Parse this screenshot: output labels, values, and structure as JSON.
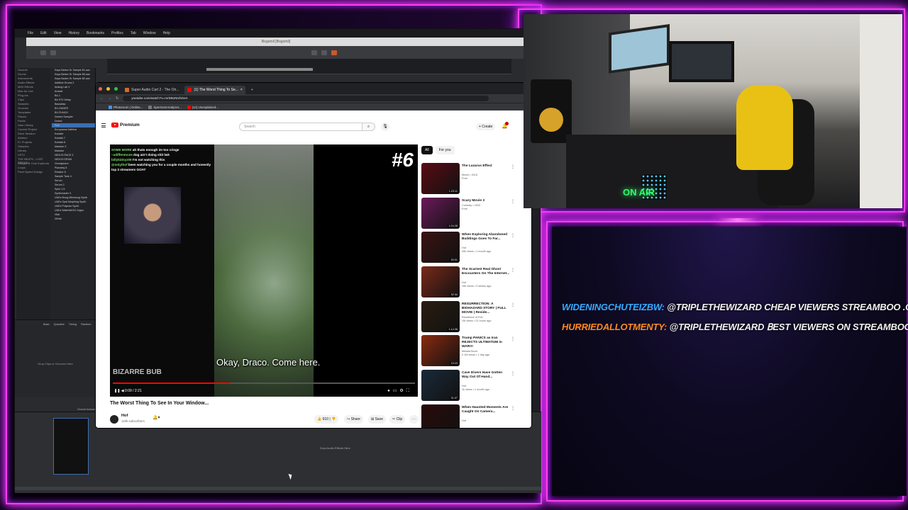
{
  "daw": {
    "menu": [
      "File",
      "Edit",
      "View",
      "History",
      "Bookmarks",
      "Profiles",
      "Tab",
      "Window",
      "Help"
    ],
    "window_title": "Bogomil [Bogomil]",
    "plugins": [
      "Kaya Barker Dr Sample B1.aax",
      "Kaya Barker Dr Sample B4.aax",
      "Kaya Barker Dr Sample B2.aax",
      "Additive Drums 2",
      "Analog Lab V",
      "Arcade",
      "BA-1",
      "BA STX Delay",
      "Bassalisa",
      "BX-HAVIER",
      "BX-PUNCH",
      "Decent Sampler",
      "Dexed",
      "Flux",
      "Europeana Gallrina",
      "Kontakt",
      "Kontakt 7",
      "Kontakt 8",
      "Massive X",
      "Massive",
      "NEXUS RACE 3",
      "NEXUS DRUM",
      "Omnisphere",
      "Pianoteq 8",
      "Reactor 6",
      "Sample Tank 4",
      "Serum",
      "Serum 2",
      "Spire 1.5",
      "Synthmaster 3",
      "UADx Moog Minimoog Synth",
      "UADx Opal Morphing Synth",
      "UADx Polymax Synth",
      "UADx Waterfall B3 Organ",
      "Vital",
      "Xfinite"
    ],
    "categories": [
      "Sounds",
      "Drums",
      "Instruments",
      "Audio Effects",
      "MIDI Effects",
      "Max for Live",
      "Plug-Ins",
      "Clips",
      "Samples",
      "Grooves",
      "Templates",
      "Places",
      "Packs",
      "User Library",
      "Current Project",
      "Drive Session",
      "Ableton",
      "FL Projects",
      "Samples",
      "Library",
      "VST2",
      "THE BEATS - LOST TREASU",
      "Ranges & Club Euphoria",
      "Loops",
      "Fleet Speed Design"
    ],
    "clip_headers": [
      "Base",
      "Quantize",
      "Timing",
      "Random",
      "Vel"
    ],
    "drop_clips": "Drop Clips or Grooves Here",
    "drop_fx": "Drop Audio Effects Here",
    "groove_label": "Groove Amount"
  },
  "browser": {
    "tabs": [
      {
        "label": "Super Audio Cart 2 - The Ori..."
      },
      {
        "label": "(1) The Worst Thing To Se..."
      }
    ],
    "url": "youtube.com/watch?v=mrD8oNIchGeA",
    "bookmarks": [
      "Photoroom | Online...",
      "SpectrumAnalyzer...",
      "(14) Unexplained..."
    ]
  },
  "youtube": {
    "premium_label": "Premium",
    "search_placeholder": "Search",
    "create_label": "+ Create",
    "chat_overlay": [
      {
        "user": "SOME MORE",
        "text": "ah thats enough im too cringe"
      },
      {
        "user": "~adifferencee",
        "text": "dog ain't doing shit lwk"
      },
      {
        "user": "billykidnyz09",
        "text": "I'm not watching this"
      },
      {
        "user": "@onlythof",
        "text": "been watching you for a couple months and honestly top 3 streamers GOAT"
      }
    ],
    "episode": "#6",
    "subtitle": "Okay, Draco. Come here.",
    "watermark": "BIZARRE BUB",
    "progress": 0.39,
    "time": "0:09 / 2:21",
    "video_title": "The Worst Thing To See In Your Window...",
    "channel_name": "Hof",
    "channel_subs": "119k subscribers",
    "likes": "610",
    "share": "Share",
    "save": "Save",
    "clip": "Clip",
    "chips": [
      "All",
      "For you"
    ],
    "recommendations": [
      {
        "title": "The Lazarus Effect",
        "meta1": "Movie • 2015",
        "meta2": "Free",
        "duration": "1:23:11",
        "thumb": "#5a0b14"
      },
      {
        "title": "Scary Movie 3",
        "meta1": "Comedy • 2003",
        "meta2": "Free",
        "duration": "1:24:28",
        "thumb": "#6b1a5a"
      },
      {
        "title": "When Exploring Abandoned Buildings Goes To Far...",
        "meta1": "Hof",
        "meta2": "49k views • 1 month ago",
        "duration": "30:01",
        "thumb": "#3b1212"
      },
      {
        "title": "The Scariest Real Ghost Encounters On The Internet...",
        "meta1": "Hof",
        "meta2": "15k views • 3 weeks ago",
        "duration": "32:34",
        "thumb": "#7a2a1a"
      },
      {
        "title": "RESURRECTION: A BIOHAZARD STORY | FULL MOVIE | Reside...",
        "meta1": "Residence of Evil",
        "meta2": "1M views • 21 hours ago",
        "duration": "1:14:38",
        "thumb": "#2a1d10"
      },
      {
        "title": "Trump PANICS as Iran REJECTS ULTIMATUM in WAR!!!",
        "meta1": "MeidasTouch",
        "meta2": "2.1M views • 1 day ago",
        "duration": "19:23",
        "thumb": "#8a2a10"
      },
      {
        "title": "Cave Divers Have Gotten Way Out Of Hand...",
        "meta1": "Hof",
        "meta2": "1k views • 1 month ago",
        "duration": "31:07",
        "thumb": "#1a2a3a"
      },
      {
        "title": "When Haunted Moments Are Caught On Camera...",
        "meta1": "Hof",
        "meta2": "",
        "duration": "",
        "thumb": "#2a0a0a"
      }
    ]
  },
  "webcam": {
    "sign": "ON AIR"
  },
  "chat": {
    "messages": [
      {
        "user": "WIDENINGCHUTEIZBW:",
        "text": "@TRIPLETHEWIZARD CHEAP VIEWERS STREAMBOO .COM (R"
      },
      {
        "user": "HURRIEDALLOTMENTY:",
        "text": "@TRIPLETHEWIZARD ꓐEST VIEWERS ON STREAMBOO .COM"
      }
    ]
  },
  "colors": {
    "neon": "#ff3df0",
    "user1": "#38a9ff",
    "user2": "#ff8a1f",
    "yt_red": "#ff0000"
  }
}
